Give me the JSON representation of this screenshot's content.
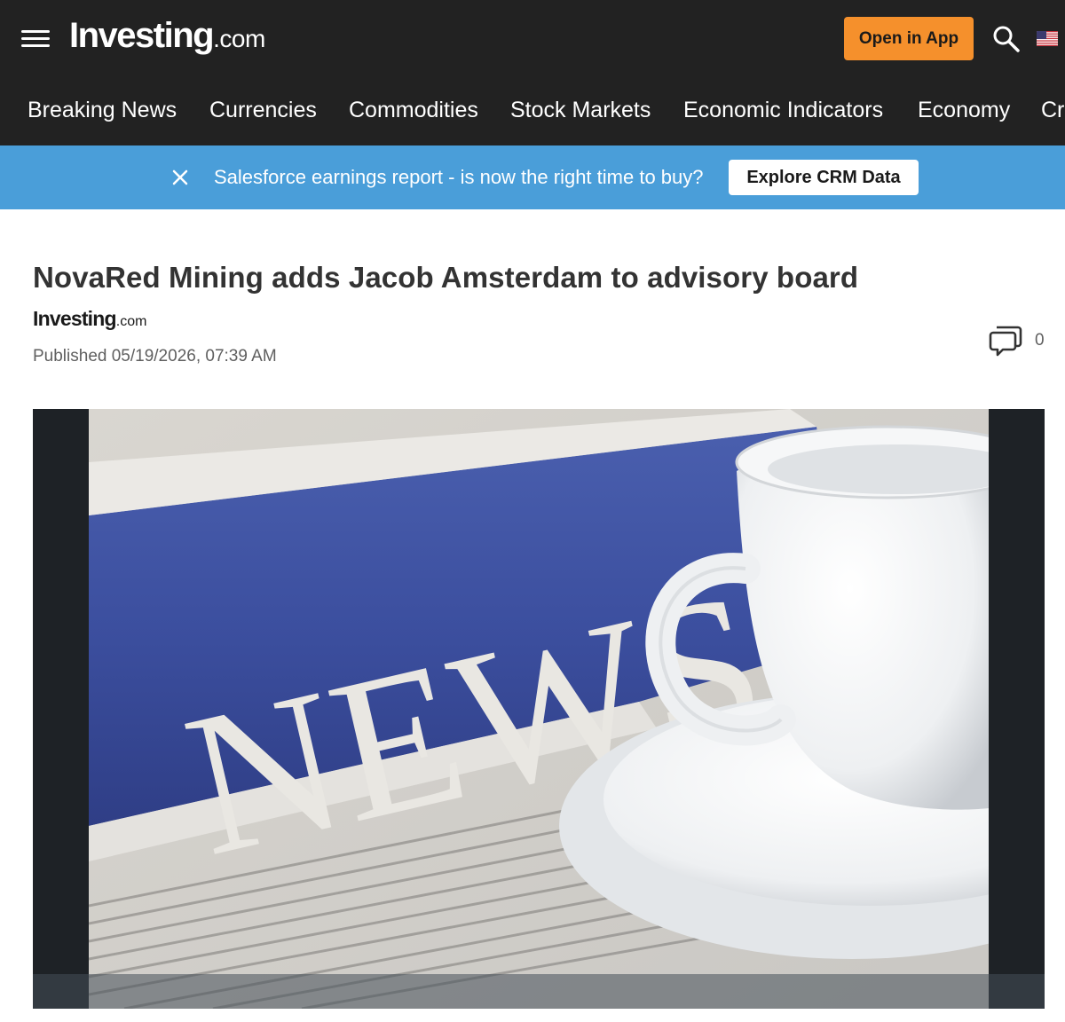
{
  "header": {
    "logo_main": "Investing",
    "logo_suffix": ".com",
    "open_app_label": "Open in App",
    "icons": [
      "menu-icon",
      "search-icon",
      "us-flag-icon"
    ]
  },
  "nav": {
    "items": [
      {
        "label": "Breaking News"
      },
      {
        "label": "Currencies"
      },
      {
        "label": "Commodities"
      },
      {
        "label": "Stock Markets"
      },
      {
        "label": "Economic Indicators"
      },
      {
        "label": "Economy"
      },
      {
        "label": "Cr"
      }
    ]
  },
  "banner": {
    "text": "Salesforce earnings report - is now the right time to buy?",
    "cta_label": "Explore CRM Data",
    "color": "#4a9ed9"
  },
  "article": {
    "title": "NovaRed Mining adds Jacob Amsterdam to advisory board",
    "source_main": "Investing",
    "source_suffix": ".com",
    "published": "Published 05/19/2026, 07:39 AM",
    "comment_count": "0",
    "image_text": "NEWS"
  },
  "colors": {
    "header_bg": "#222222",
    "accent_orange": "#f5902c",
    "banner_blue": "#4a9ed9"
  }
}
